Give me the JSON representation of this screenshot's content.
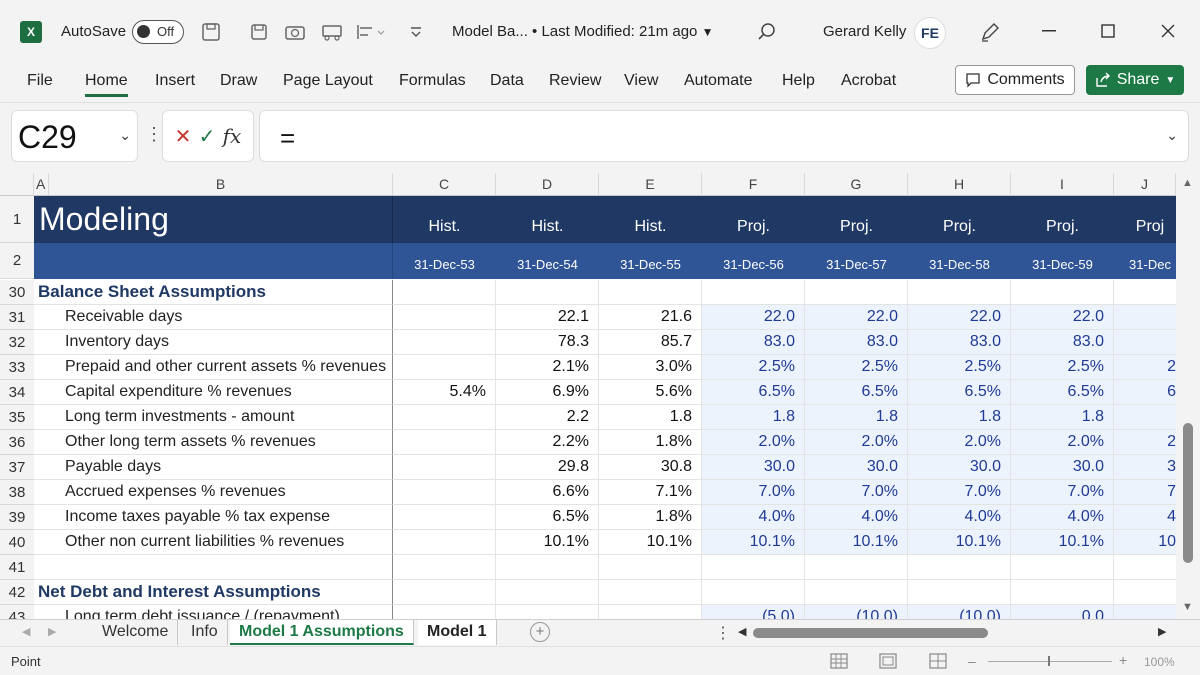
{
  "titlebar": {
    "app_icon": "X",
    "autosave_label": "AutoSave",
    "autosave_state": "Off",
    "doc_title": "Model Ba... • Last Modified: 21m ago",
    "user_name": "Gerard Kelly",
    "avatar_initials": "FE"
  },
  "ribbon": {
    "tabs": [
      "File",
      "Home",
      "Insert",
      "Draw",
      "Page Layout",
      "Formulas",
      "Data",
      "Review",
      "View",
      "Automate",
      "Help",
      "Acrobat"
    ],
    "active_tab": "Home",
    "comments_label": "Comments",
    "share_label": "Share"
  },
  "formula_bar": {
    "name_box": "C29",
    "formula": "="
  },
  "columns": [
    "A",
    "B",
    "C",
    "D",
    "E",
    "F",
    "G",
    "H",
    "I",
    "J"
  ],
  "header_rows": {
    "row1": {
      "num": "1",
      "title": "Modeling",
      "cells": [
        "Hist.",
        "Hist.",
        "Hist.",
        "Proj.",
        "Proj.",
        "Proj.",
        "Proj.",
        "Proj"
      ]
    },
    "row2": {
      "num": "2",
      "cells": [
        "31-Dec-53",
        "31-Dec-54",
        "31-Dec-55",
        "31-Dec-56",
        "31-Dec-57",
        "31-Dec-58",
        "31-Dec-59",
        "31-Dec"
      ]
    }
  },
  "rows": [
    {
      "num": "30",
      "section": "Balance Sheet Assumptions",
      "values": [
        "",
        "",
        "",
        "",
        "",
        "",
        "",
        ""
      ]
    },
    {
      "num": "31",
      "label": "Receivable days",
      "values": [
        "",
        "22.1",
        "21.6",
        "22.0",
        "22.0",
        "22.0",
        "22.0",
        ""
      ]
    },
    {
      "num": "32",
      "label": "Inventory days",
      "values": [
        "",
        "78.3",
        "85.7",
        "83.0",
        "83.0",
        "83.0",
        "83.0",
        ""
      ]
    },
    {
      "num": "33",
      "label": "Prepaid and other current assets % revenues",
      "values": [
        "",
        "2.1%",
        "3.0%",
        "2.5%",
        "2.5%",
        "2.5%",
        "2.5%",
        "2"
      ]
    },
    {
      "num": "34",
      "label": "Capital expenditure % revenues",
      "values": [
        "5.4%",
        "6.9%",
        "5.6%",
        "6.5%",
        "6.5%",
        "6.5%",
        "6.5%",
        "6"
      ]
    },
    {
      "num": "35",
      "label": "Long term investments - amount",
      "values": [
        "",
        "2.2",
        "1.8",
        "1.8",
        "1.8",
        "1.8",
        "1.8",
        ""
      ]
    },
    {
      "num": "36",
      "label": "Other long term assets % revenues",
      "values": [
        "",
        "2.2%",
        "1.8%",
        "2.0%",
        "2.0%",
        "2.0%",
        "2.0%",
        "2"
      ]
    },
    {
      "num": "37",
      "label": "Payable days",
      "values": [
        "",
        "29.8",
        "30.8",
        "30.0",
        "30.0",
        "30.0",
        "30.0",
        "3"
      ]
    },
    {
      "num": "38",
      "label": "Accrued expenses % revenues",
      "values": [
        "",
        "6.6%",
        "7.1%",
        "7.0%",
        "7.0%",
        "7.0%",
        "7.0%",
        "7"
      ]
    },
    {
      "num": "39",
      "label": "Income taxes payable % tax expense",
      "values": [
        "",
        "6.5%",
        "1.8%",
        "4.0%",
        "4.0%",
        "4.0%",
        "4.0%",
        "4"
      ]
    },
    {
      "num": "40",
      "label": "Other non current liabilities % revenues",
      "values": [
        "",
        "10.1%",
        "10.1%",
        "10.1%",
        "10.1%",
        "10.1%",
        "10.1%",
        "10"
      ]
    },
    {
      "num": "41",
      "label": "",
      "values": [
        "",
        "",
        "",
        "",
        "",
        "",
        "",
        ""
      ]
    },
    {
      "num": "42",
      "section": "Net Debt and Interest Assumptions",
      "values": [
        "",
        "",
        "",
        "",
        "",
        "",
        "",
        ""
      ]
    },
    {
      "num": "43",
      "label": "Long term debt issuance / (repayment)",
      "values": [
        "",
        "",
        "",
        "(5.0)",
        "(10.0)",
        "(10.0)",
        "0.0",
        ""
      ]
    }
  ],
  "sheets": [
    "Welcome",
    "Info",
    "Model 1 Assumptions",
    "Model 1"
  ],
  "active_sheet": "Model 1 Assumptions",
  "status": {
    "mode": "Point",
    "zoom": "100%"
  },
  "colors": {
    "band1": "#1f3864",
    "band2": "#2f5597",
    "proj_fill": "#edf3fc",
    "proj_text": "#1f3a93",
    "accent": "#1d7a46"
  }
}
